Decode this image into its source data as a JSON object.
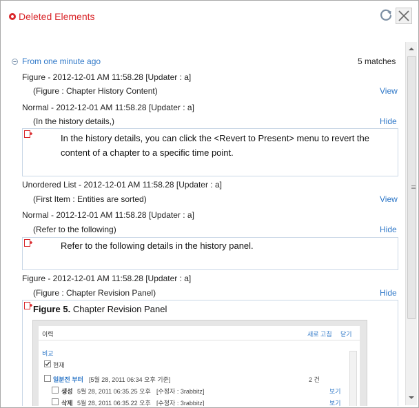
{
  "window": {
    "title": "Deleted Elements"
  },
  "group": {
    "label": "From one minute ago",
    "matches": "5 matches"
  },
  "entries": [
    {
      "header": "Figure - 2012-12-01 AM 11:58.28 [Updater : a]",
      "summary": "(Figure : Chapter History Content)",
      "action": "View"
    },
    {
      "header": "Normal - 2012-12-01 AM 11:58.28 [Updater : a]",
      "summary": "(In the history details,)",
      "action": "Hide",
      "content": "In the history details, you can click the <Revert to Present> menu to revert the content of a chapter to a specific time point."
    },
    {
      "header": "Unordered List - 2012-12-01 AM 11:58.28 [Updater : a]",
      "summary": "(First Item : Entities are sorted)",
      "action": "View"
    },
    {
      "header": "Normal - 2012-12-01 AM 11:58.28 [Updater : a]",
      "summary": "(Refer to the following)",
      "action": "Hide",
      "content": "Refer to the following details in the history panel."
    },
    {
      "header": "Figure - 2012-12-01 AM 11:58.28 [Updater : a]",
      "summary": "(Figure : Chapter Revision Panel)",
      "action": "Hide",
      "figure_label": "Figure 5.",
      "figure_title": "Chapter Revision Panel"
    }
  ],
  "embedded": {
    "title": "이력",
    "refresh": "새로 고침",
    "close": "닫기",
    "compare": "비교",
    "current": "현재",
    "branch": "일분전 부터",
    "branch_date": "[5월 28, 2011 06:34 오후 기준]",
    "count": "2 건",
    "rows": [
      {
        "action": "생성",
        "date": "5월 28, 2011 06:35.25 오후",
        "editor": "[수정자 : 3rabbitz]",
        "link": "보기"
      },
      {
        "action": "삭제",
        "date": "5월 28, 2011 06:35.22 오후",
        "editor": "[수정자 : 3rabbitz]",
        "link": "보기"
      }
    ]
  },
  "colors": {
    "accent": "#d9262a",
    "link": "#2f78c8"
  }
}
